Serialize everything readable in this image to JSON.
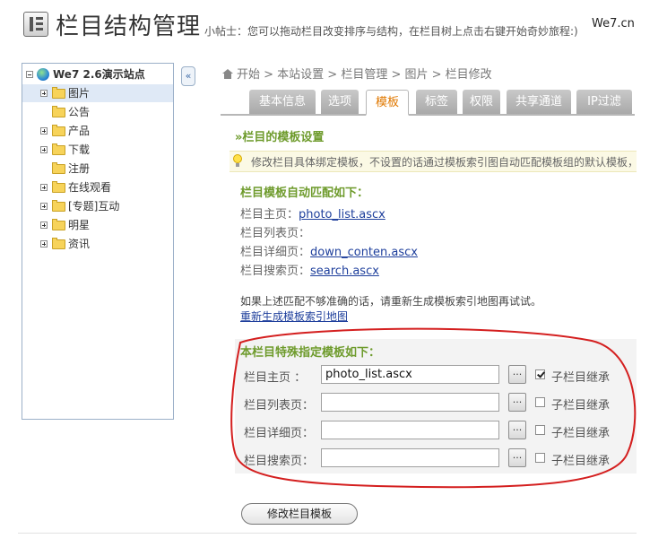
{
  "header": {
    "title": "栏目结构管理",
    "tip": "小帖士：您可以拖动栏目改变排序与结构，在栏目树上点击右键开始奇妙旅程:)",
    "brand": "We7.cn"
  },
  "tree": {
    "root": "We7 2.6演示站点",
    "items": [
      {
        "label": "图片",
        "expandable": true,
        "selected": true
      },
      {
        "label": "公告",
        "expandable": false
      },
      {
        "label": "产品",
        "expandable": true
      },
      {
        "label": "下载",
        "expandable": true
      },
      {
        "label": "注册",
        "expandable": false
      },
      {
        "label": "在线观看",
        "expandable": true
      },
      {
        "label": "[专题]互动",
        "expandable": true
      },
      {
        "label": "明星",
        "expandable": true
      },
      {
        "label": "资讯",
        "expandable": true
      }
    ],
    "collapse_glyph": "«"
  },
  "breadcrumb": {
    "text": "开始 > 本站设置 > 栏目管理 > 图片 > 栏目修改"
  },
  "tabs": [
    {
      "label": "基本信息"
    },
    {
      "label": "选项"
    },
    {
      "label": "模板",
      "active": true
    },
    {
      "label": "标签"
    },
    {
      "label": "权限"
    },
    {
      "label": "共享通道"
    },
    {
      "label": "IP过滤"
    }
  ],
  "panel": {
    "title": "»栏目的模板设置",
    "hint": "修改栏目具体绑定模板，不设置的话通过模板索引图自动匹配模板组的默认模板，"
  },
  "auto_match": {
    "title": "栏目模板自动匹配如下：",
    "rows": [
      {
        "label": "栏目主页：",
        "value": "photo_list.ascx"
      },
      {
        "label": "栏目列表页：",
        "value": ""
      },
      {
        "label": "栏目详细页：",
        "value": "down_conten.ascx"
      },
      {
        "label": "栏目搜索页：",
        "value": "search.ascx"
      }
    ],
    "note": "如果上述匹配不够准确的话，请重新生成模板索引地图再试试。",
    "regen_link": "重新生成模板索引地图"
  },
  "special": {
    "title": "本栏目特殊指定模板如下：",
    "rows": [
      {
        "label": "栏目主页 ：",
        "value": "photo_list.ascx",
        "checked": true
      },
      {
        "label": "栏目列表页：",
        "value": "",
        "checked": false
      },
      {
        "label": "栏目详细页：",
        "value": "",
        "checked": false
      },
      {
        "label": "栏目搜索页：",
        "value": "",
        "checked": false
      }
    ],
    "browse_label": "...",
    "inherit_label": "子栏目继承"
  },
  "submit_label": "修改栏目模板",
  "colors": {
    "accent_green": "#6e9b2c",
    "tab_active": "#e07800",
    "link": "#1e3f9c",
    "annotation_red": "#d41f1f"
  }
}
